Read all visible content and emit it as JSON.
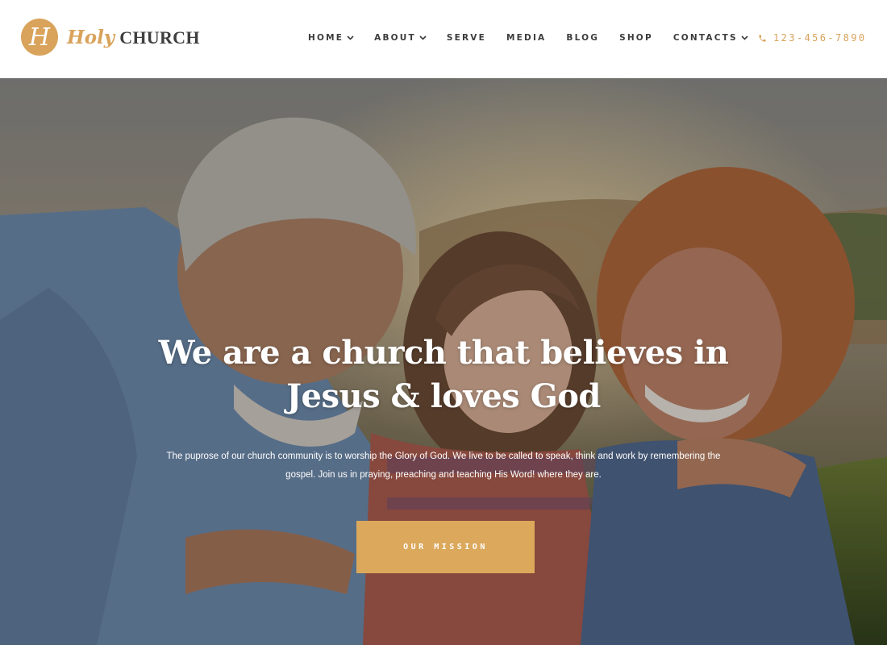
{
  "colors": {
    "accent": "#d9a35b",
    "nav_text": "#3c3c3c",
    "heading": "#ffffff",
    "button_bg": "#dba85c"
  },
  "brand": {
    "monogram": "H",
    "name_script": "Holy",
    "name_caps": "CHURCH"
  },
  "nav": {
    "items": [
      {
        "label": "HOME",
        "has_dropdown": true
      },
      {
        "label": "ABOUT",
        "has_dropdown": true
      },
      {
        "label": "SERVE",
        "has_dropdown": false
      },
      {
        "label": "MEDIA",
        "has_dropdown": false
      },
      {
        "label": "BLOG",
        "has_dropdown": false
      },
      {
        "label": "SHOP",
        "has_dropdown": false
      },
      {
        "label": "CONTACTS",
        "has_dropdown": true
      }
    ],
    "dropdown_icon": "chevron-down-icon"
  },
  "contact": {
    "icon": "phone-icon",
    "phone": "123-456-7890"
  },
  "hero": {
    "heading_line1": "We are a church that believes in",
    "heading_line2": "Jesus & loves God",
    "text_line1": "The puprose of our church community is to worship the Glory of God. We live to be called to speak, think and work by remembering the",
    "text_line2": "gospel. Join us in praying, preaching and teaching His Word! where they are.",
    "button_label": "OUR MISSION"
  }
}
